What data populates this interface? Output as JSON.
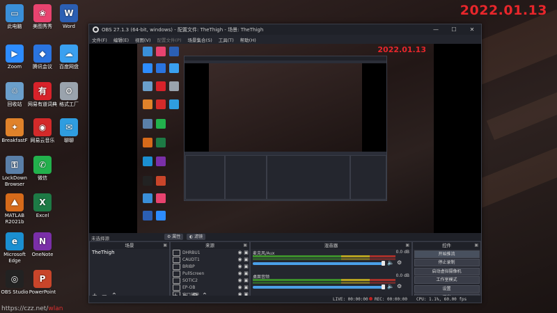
{
  "desktop": {
    "date_overlay": "2022.01.13",
    "watermark_prefix": "https://czz.net/",
    "watermark_suffix": "wlan",
    "icons": [
      {
        "label": "此电脑",
        "color": "#3a8fd9",
        "glyph": "▭"
      },
      {
        "label": "美图秀秀",
        "color": "#e8436f",
        "glyph": "❀"
      },
      {
        "label": "Word",
        "color": "#2b5fb4",
        "glyph": "W"
      },
      {
        "label": "Zoom",
        "color": "#2d8cff",
        "glyph": "▶"
      },
      {
        "label": "腾讯会议",
        "color": "#2a74e0",
        "glyph": "◆"
      },
      {
        "label": "百度网盘",
        "color": "#3aa0f0",
        "glyph": "☁"
      },
      {
        "label": "回收站",
        "color": "#6b9fcb",
        "glyph": "♲"
      },
      {
        "label": "网易有道词典",
        "color": "#d8222a",
        "glyph": "有"
      },
      {
        "label": "格式工厂",
        "color": "#9aa3ad",
        "glyph": "⚙"
      },
      {
        "label": "BreakfastF",
        "color": "#e0822a",
        "glyph": "✦"
      },
      {
        "label": "网易云音乐",
        "color": "#d42a2a",
        "glyph": "◉"
      },
      {
        "label": "聊聊",
        "color": "#2f9de0",
        "glyph": "✉"
      },
      {
        "label": "LockDown Browser",
        "color": "#5a7fa8",
        "glyph": "⚿"
      },
      {
        "label": "微信",
        "color": "#22b14c",
        "glyph": "✆"
      },
      {
        "label": "MATLAB R2021b",
        "color": "#d66a1a",
        "glyph": "⛰"
      },
      {
        "label": "Excel",
        "color": "#1d7a45",
        "glyph": "X"
      },
      {
        "label": "Microsoft Edge",
        "color": "#1b8fd1",
        "glyph": "e"
      },
      {
        "label": "OneNote",
        "color": "#7a2fa8",
        "glyph": "N"
      },
      {
        "label": "OBS Studio",
        "color": "#222222",
        "glyph": "◎"
      },
      {
        "label": "PowerPoint",
        "color": "#c9452a",
        "glyph": "P"
      }
    ]
  },
  "obs": {
    "title": "OBS 27.1.3 (64-bit, windows) - 配置文件: TheThigh - 场景: TheThigh",
    "window_controls": {
      "minimize": "—",
      "maximize": "☐",
      "close": "✕"
    },
    "menu": [
      "文件(F)",
      "编辑(E)",
      "视图(V)",
      "配置文件(P)",
      "场景集合(S)",
      "工具(T)",
      "帮助(H)"
    ],
    "preview_date": "2022.01.13",
    "dock_bar": {
      "no_source": "未选择源",
      "props_btn": "属性",
      "filters_btn": "滤镜"
    },
    "scenes": {
      "title": "场景",
      "items": [
        "TheThigh"
      ],
      "footer": [
        "+",
        "−",
        "⌃",
        "⌄"
      ]
    },
    "sources": {
      "title": "来源",
      "items": [
        "DHRBU1",
        "CAUDT1",
        "BRIBP",
        "PullScreen",
        "SOTIC2",
        "EP-OB",
        "窗口捕获"
      ],
      "footer": [
        "+",
        "−",
        "⚙",
        "⌃",
        "⌄"
      ]
    },
    "mixer": {
      "title": "混音器",
      "channels": [
        {
          "name": "麦克风/Aux",
          "db": "0.0 dB"
        },
        {
          "name": "桌面音频",
          "db": "0.0 dB"
        }
      ]
    },
    "controls": {
      "title": "控件",
      "buttons": [
        "开始推流",
        "停止录制",
        "启动虚拟摄像机",
        "工作室模式",
        "设置",
        "退出"
      ]
    },
    "status": {
      "live": "LIVE: 00:00:00",
      "rec": "REC: 00:00:00",
      "cpu": "CPU: 1.1%, 60.00 fps"
    }
  }
}
